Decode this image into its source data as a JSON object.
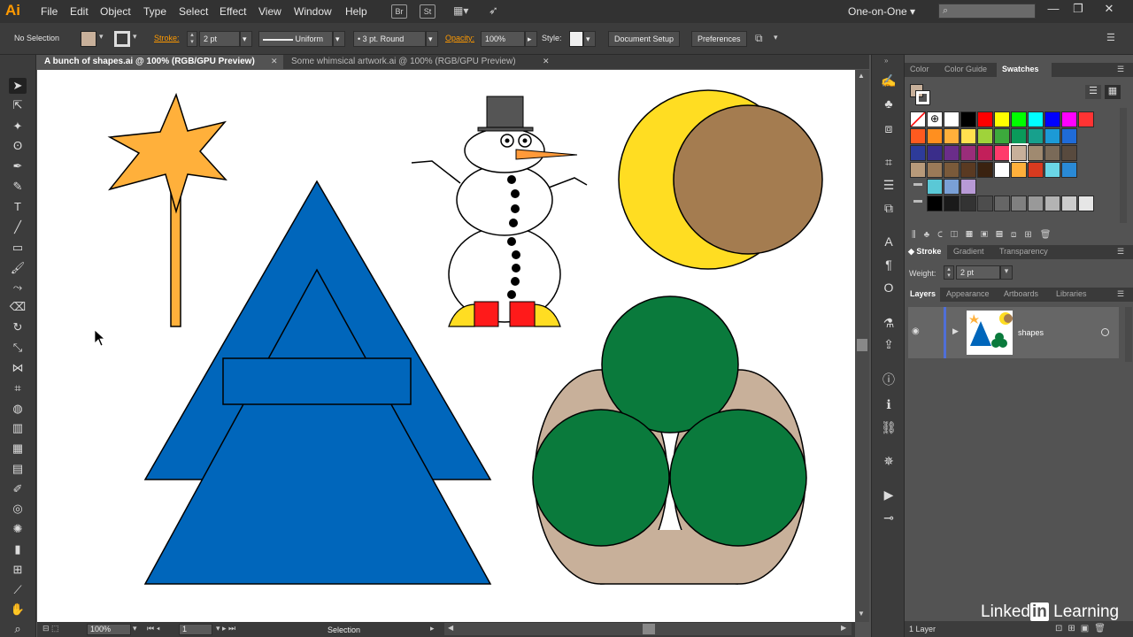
{
  "app": {
    "logo": "Ai"
  },
  "menu": [
    "File",
    "Edit",
    "Object",
    "Type",
    "Select",
    "Effect",
    "View",
    "Window",
    "Help"
  ],
  "menu_buttons": [
    "Br",
    "St"
  ],
  "workspace": {
    "label": "One-on-One"
  },
  "control_bar": {
    "selection": "No Selection",
    "stroke_label": "Stroke:",
    "stroke_weight": "2 pt",
    "stroke_profile": "Uniform",
    "brush": "3 pt. Round",
    "opacity_label": "Opacity:",
    "opacity": "100%",
    "style_label": "Style:",
    "doc_setup": "Document Setup",
    "preferences": "Preferences"
  },
  "tabs": [
    {
      "label": "A bunch of shapes.ai @ 100% (RGB/GPU Preview)",
      "active": true
    },
    {
      "label": "Some whimsical artwork.ai @ 100% (RGB/GPU Preview)",
      "active": false
    }
  ],
  "status": {
    "zoom": "100%",
    "artboard": "1",
    "tool": "Selection"
  },
  "panels": {
    "color_tabs": [
      "Color",
      "Color Guide",
      "Swatches"
    ],
    "stroke_tabs": [
      "Stroke",
      "Gradient",
      "Transparency"
    ],
    "weight_label": "Weight:",
    "weight_value": "2 pt",
    "layer_tabs": [
      "Appearance",
      "Artboards",
      "Libraries"
    ],
    "layers_tab": "Layers",
    "layer_name": "shapes",
    "layer_count": "1 Layer"
  },
  "watermark": {
    "text": "Linked",
    "in": "in",
    "learning": "Learning"
  },
  "colors": {
    "star": "#ffb03b",
    "tree": "#0066bb",
    "moon": "#ffdd22",
    "moon_inner": "#a47c50",
    "tree_green": "#0a7a3c",
    "trunk": "#c8b09a",
    "snowman_feet": "#ffdd22",
    "snowman_boots": "#ff1a1a",
    "hat": "#555555",
    "carrot": "#ff9a3a"
  }
}
